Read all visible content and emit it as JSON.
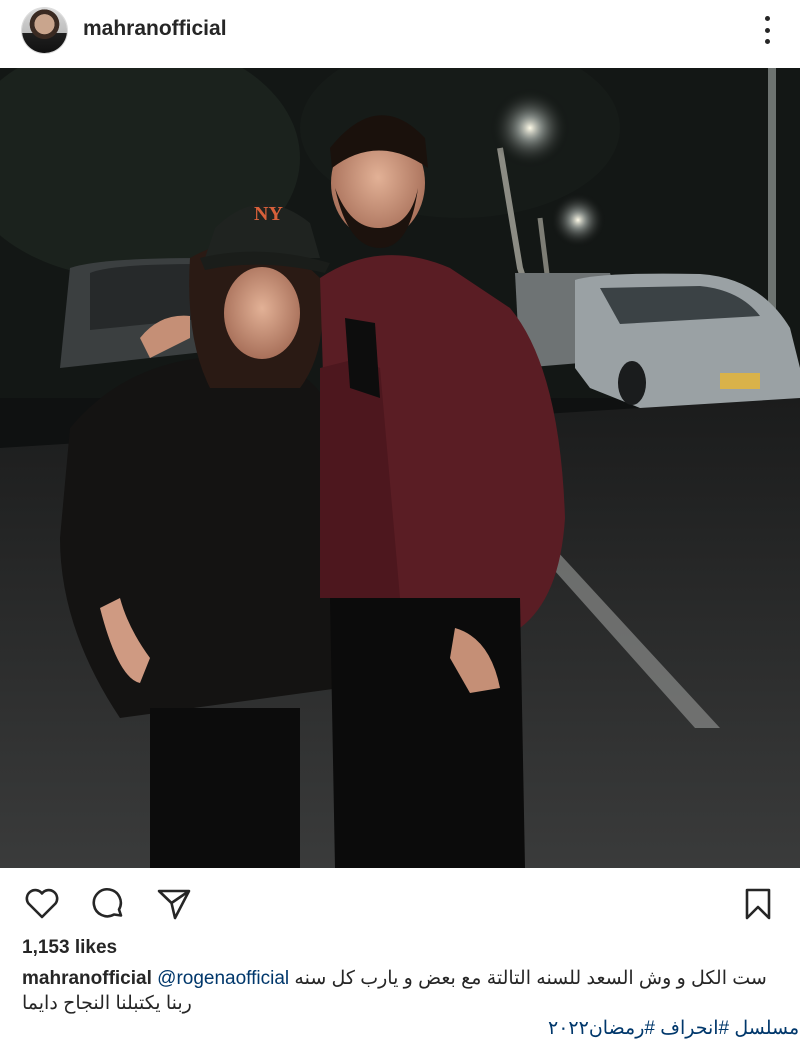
{
  "post": {
    "username": "mahranofficial",
    "likes": "1,153 likes",
    "caption": {
      "username": "mahranofficial",
      "mention": "@rogenaofficial",
      "line1": "ست الكل و وش السعد للسنه التالتة مع بعض و يارب كل سنه",
      "line2": "ربنا يكتبلنا النجاح دايما",
      "line3": "مسلسل #انحراف #رمضان٢٠٢٢"
    }
  },
  "icons": {
    "more": "more-options-icon",
    "like": "heart-icon",
    "comment": "comment-icon",
    "share": "send-icon",
    "save": "bookmark-icon"
  },
  "colors": {
    "text": "#262626",
    "link": "#00376b",
    "background": "#ffffff"
  }
}
